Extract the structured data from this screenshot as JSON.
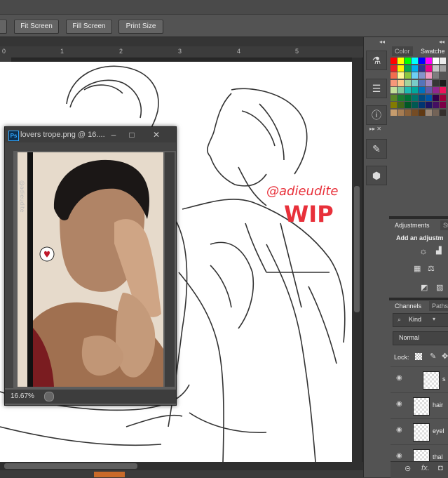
{
  "options_bar": {
    "buttons": [
      "Fit Screen",
      "Fill Screen",
      "Print Size"
    ]
  },
  "ruler": {
    "marks": [
      "0",
      "1",
      "2",
      "3",
      "4",
      "5"
    ]
  },
  "canvas": {
    "watermark_line1": "@adieudite",
    "watermark_line2": "WIP"
  },
  "floating_window": {
    "title": "lovers trope.png @ 16....",
    "zoom": "16.67%",
    "side_text": "@adieudite",
    "ps_badge": "Ps"
  },
  "panels": {
    "color_tabs": [
      "Color",
      "Swatche"
    ],
    "adjustments_tabs": [
      "Adjustments",
      "St"
    ],
    "adjustments_title": "Add an adjustm",
    "layers_tabs": [
      "Channels",
      "Paths"
    ],
    "kind_label": "Kind",
    "blend_mode": "Normal",
    "lock_label": "Lock:",
    "layers": [
      "s",
      "hair",
      "eyel",
      "thal"
    ]
  },
  "colors": {
    "accent_red": "#e8303a",
    "ps_blue": "#31a8ff"
  },
  "swatch_rows": [
    [
      "#ff0000",
      "#ffff00",
      "#00ff00",
      "#00ffff",
      "#0000ff",
      "#ff00ff",
      "#ffffff",
      "#ebebeb"
    ],
    [
      "#ed1c24",
      "#fff200",
      "#00a651",
      "#00aeef",
      "#2e3192",
      "#ec008c",
      "#c7c7c7",
      "#a0a0a0"
    ],
    [
      "#f26c4f",
      "#fff799",
      "#8dc63f",
      "#6dcff6",
      "#8493ca",
      "#f49ac1",
      "#7d7d7d",
      "#555555"
    ],
    [
      "#f7977a",
      "#fdc689",
      "#a3d39c",
      "#7accc8",
      "#5674b9",
      "#a186be",
      "#363636",
      "#1c1c1c"
    ],
    [
      "#c4df9b",
      "#82ca9c",
      "#1cbbb4",
      "#00a99d",
      "#0072bc",
      "#605ca8",
      "#92278f",
      "#ed145b"
    ],
    [
      "#598527",
      "#197b30",
      "#007236",
      "#00746b",
      "#004a80",
      "#0054a6",
      "#32004b",
      "#9e0039"
    ],
    [
      "#827b00",
      "#406618",
      "#005826",
      "#005952",
      "#003471",
      "#1b1464",
      "#440e62",
      "#7b0046"
    ],
    [
      "#c69c6d",
      "#a67c52",
      "#8c6239",
      "#754c24",
      "#603913",
      "#998675",
      "#736357",
      "#362f2d"
    ]
  ]
}
